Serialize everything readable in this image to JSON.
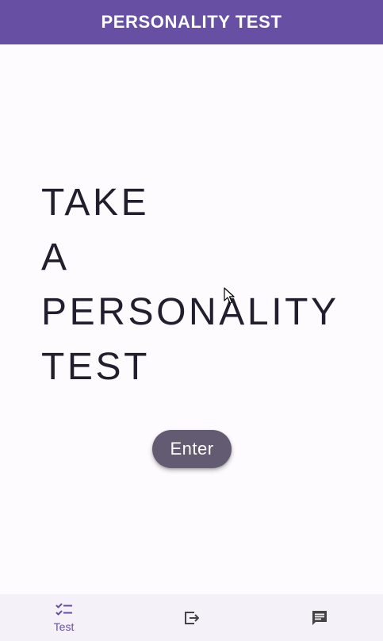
{
  "app_bar": {
    "title": "PERSONALITY TEST"
  },
  "hero": {
    "lines": [
      "TAKE",
      "A",
      "PERSONALITY",
      "TEST"
    ]
  },
  "actions": {
    "enter_label": "Enter"
  },
  "bottom_nav": {
    "items": [
      {
        "label": "Test",
        "icon": "checklist-icon",
        "selected": true
      },
      {
        "label": "",
        "icon": "logout-icon",
        "selected": false
      },
      {
        "label": "",
        "icon": "chat-icon",
        "selected": false
      }
    ]
  },
  "colors": {
    "primary": "#6750a4",
    "button": "#625b71",
    "text": "#211f2e",
    "background": "#fdfbfd",
    "nav_background": "#f4f1f8"
  }
}
